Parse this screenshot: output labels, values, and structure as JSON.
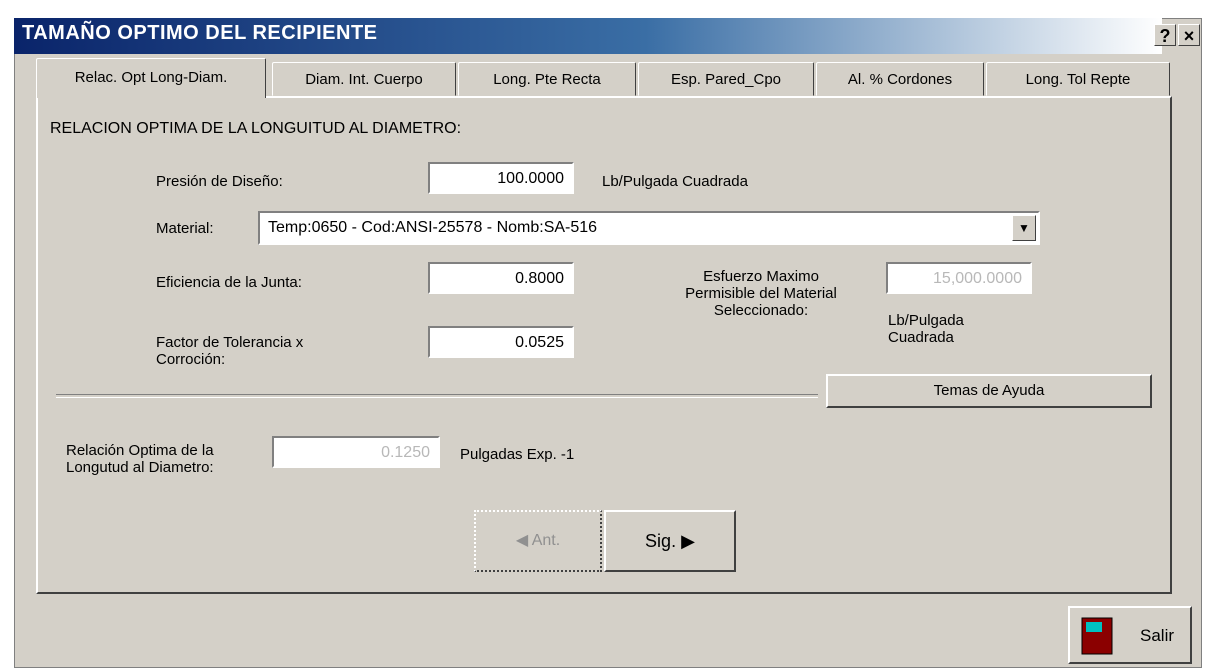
{
  "window": {
    "title": "TAMAÑO OPTIMO DEL RECIPIENTE",
    "help_button": "?",
    "close_button": "×"
  },
  "tabs": [
    {
      "label": "Relac. Opt Long-Diam."
    },
    {
      "label": "Diam. Int. Cuerpo"
    },
    {
      "label": "Long. Pte Recta"
    },
    {
      "label": "Esp. Pared_Cpo"
    },
    {
      "label": "Al. % Cordones"
    },
    {
      "label": "Long. Tol Repte"
    }
  ],
  "section": {
    "heading": "RELACION OPTIMA DE LA LONGUITUD AL DIAMETRO:"
  },
  "form": {
    "presion_label": "Presión de Diseño:",
    "presion_value": "100.0000",
    "presion_unit": "Lb/Pulgada Cuadrada",
    "material_label": "Material:",
    "material_value": "Temp:0650 - Cod:ANSI-25578 - Nomb:SA-516",
    "eficiencia_label": "Eficiencia de la Junta:",
    "eficiencia_value": "0.8000",
    "factor_label": "Factor de Tolerancia x Corroción:",
    "factor_value": "0.0525",
    "esfuerzo_label": "Esfuerzo Maximo Permisible del Material Seleccionado:",
    "esfuerzo_value": "15,000.0000",
    "esfuerzo_unit": "Lb/Pulgada Cuadrada",
    "ayuda_button": "Temas de Ayuda",
    "relacion_label": "Relación Optima de la Longutud al Diametro:",
    "relacion_value": "0.1250",
    "relacion_unit": "Pulgadas Exp. -1"
  },
  "nav": {
    "prev_label": "Ant.",
    "next_label": "Sig."
  },
  "footer": {
    "exit_label": "Salir"
  }
}
